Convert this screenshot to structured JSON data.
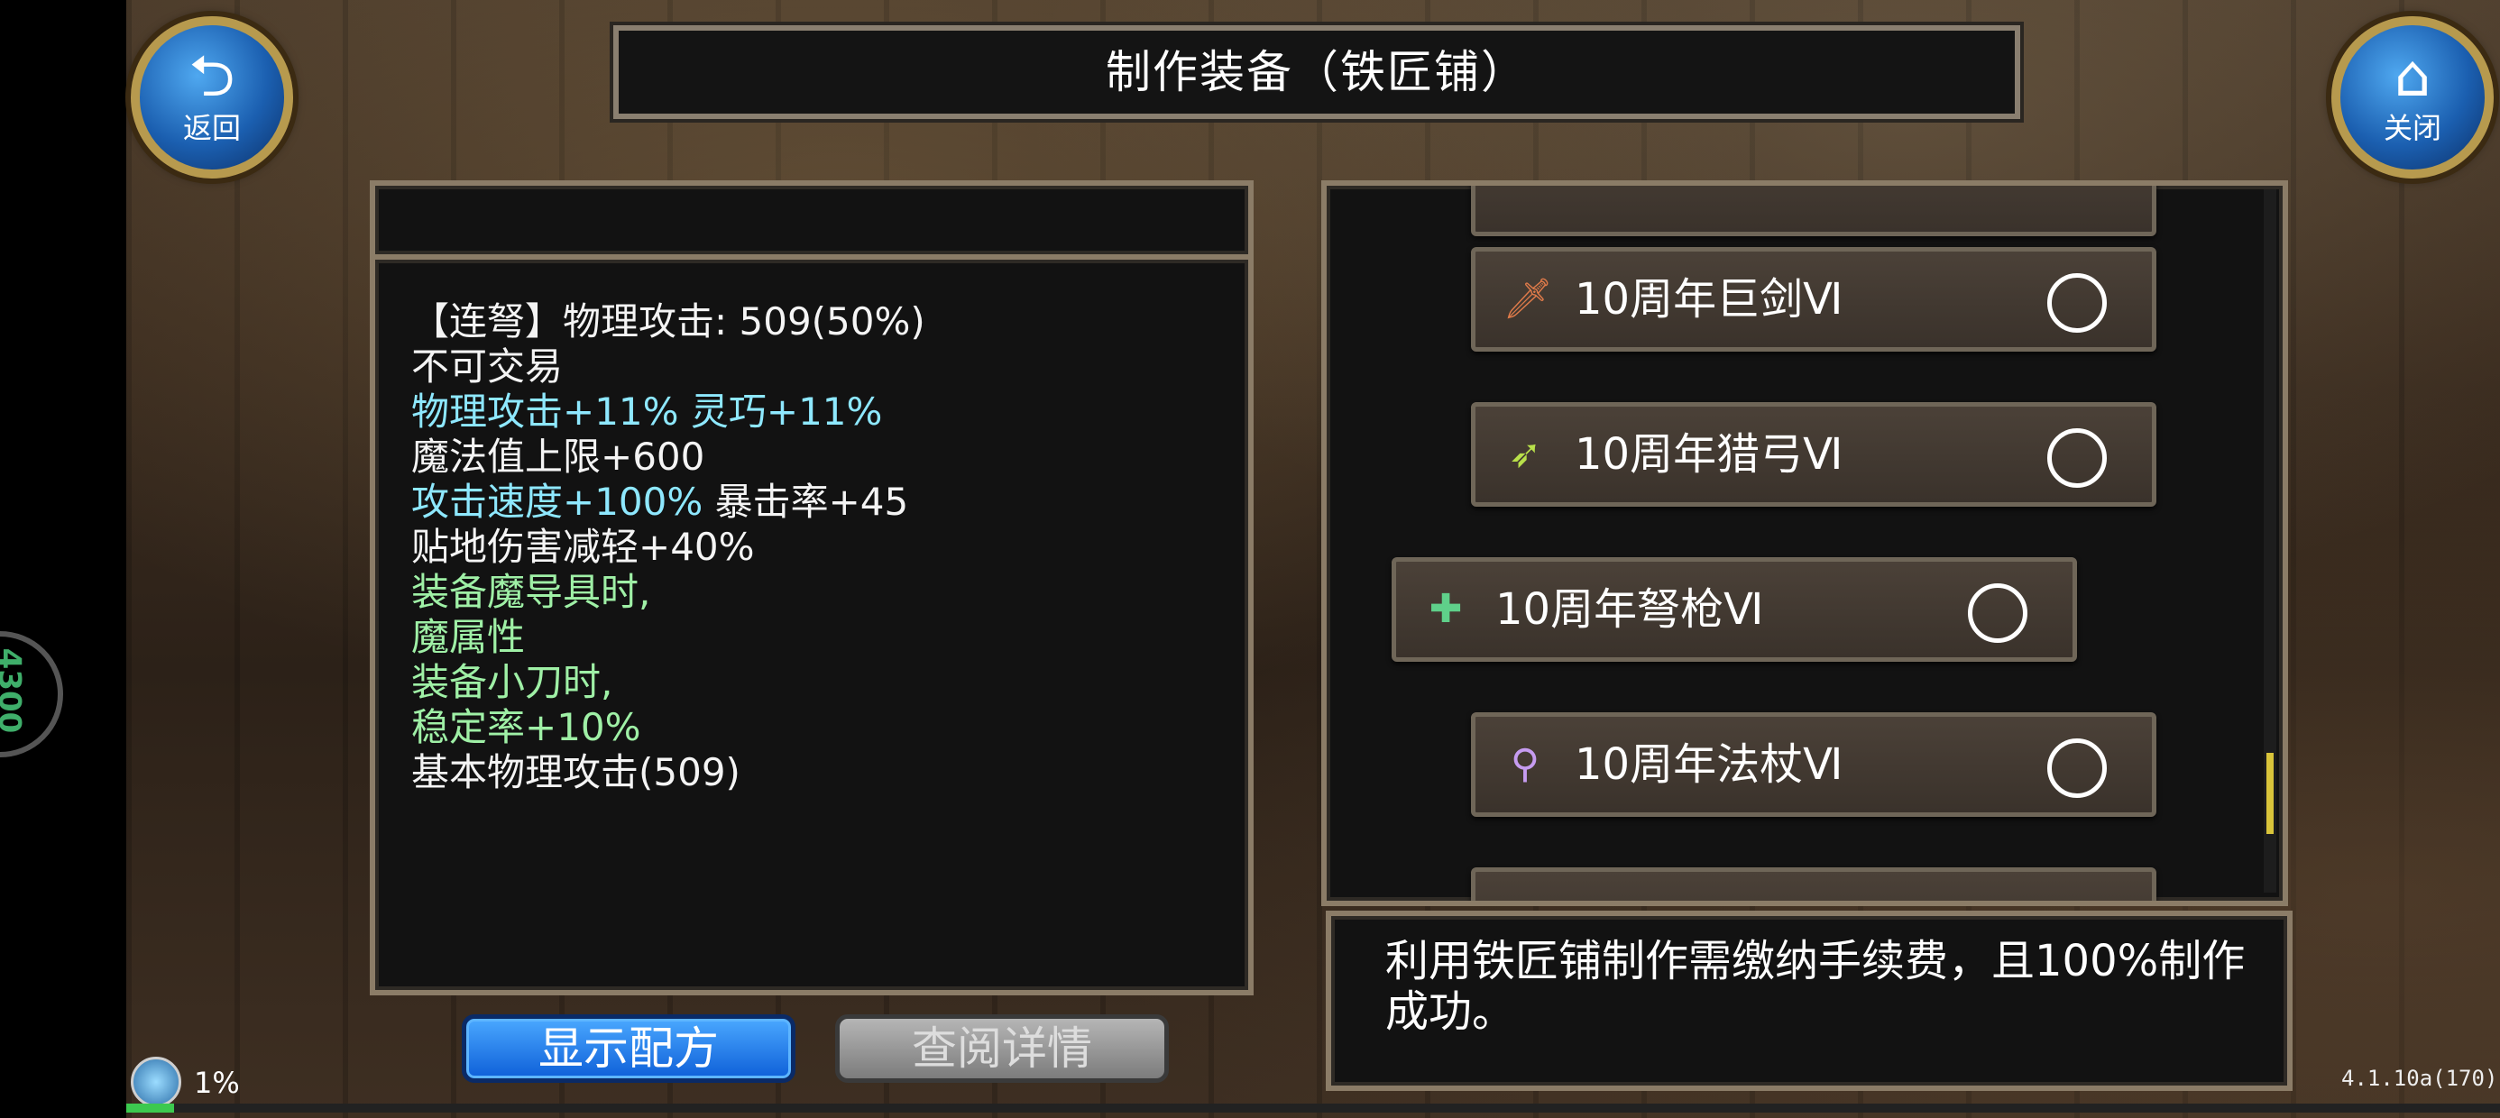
{
  "header": {
    "title": "制作装备（铁匠铺）",
    "back_label": "返回",
    "close_label": "关闭"
  },
  "side": {
    "badge_text": "4300"
  },
  "description": {
    "lines": [
      {
        "text": "【连弩】物理攻击: 509(50%)",
        "color": "white"
      },
      {
        "text": "不可交易",
        "color": "white"
      },
      {
        "text": "物理攻击+11% 灵巧+11%",
        "color": "cyan"
      },
      {
        "text": "魔法值上限+600",
        "color": "white"
      },
      {
        "text_a": "攻击速度+100%",
        "text_b": " 暴击率+45"
      },
      {
        "text": "贴地伤害减轻+40%",
        "color": "white"
      },
      {
        "text": "装备魔导具时,",
        "color": "green"
      },
      {
        "text": "魔属性",
        "color": "green"
      },
      {
        "text": "装备小刀时,",
        "color": "green"
      },
      {
        "text": "稳定率+10%",
        "color": "green"
      },
      {
        "text": "基本物理攻击(509)",
        "color": "white"
      }
    ]
  },
  "recipe_list": {
    "items": [
      {
        "name": "10周年巨剑Ⅵ",
        "icon": "sword-icon"
      },
      {
        "name": "10周年猎弓Ⅵ",
        "icon": "bow-icon"
      },
      {
        "name": "10周年弩枪Ⅵ",
        "icon": "crossbow-icon"
      },
      {
        "name": "10周年法杖Ⅵ",
        "icon": "staff-icon"
      }
    ]
  },
  "notice": {
    "text": "利用铁匠铺制作需缴纳手续费，且100%制作成功。"
  },
  "buttons": {
    "show_recipe": "显示配方",
    "view_details": "查阅详情"
  },
  "status": {
    "percent": "1%",
    "progress": 0.01,
    "version": "4.1.10a(170)"
  },
  "colors": {
    "cyan": "#8ee8ff",
    "green": "#9ff0a6",
    "white": "#f4f4f4",
    "button_blue": "#0e5fd8"
  }
}
